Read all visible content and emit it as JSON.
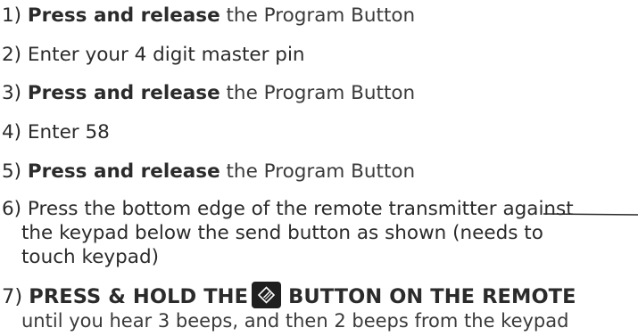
{
  "steps": [
    {
      "num": "1)",
      "bold": "Press and release",
      "rest": " the Program Button"
    },
    {
      "num": "2)",
      "text": "Enter your 4 digit master pin"
    },
    {
      "num": "3)",
      "bold": "Press and release",
      "rest": " the Program Button"
    },
    {
      "num": "4)",
      "text": "Enter 58"
    },
    {
      "num": "5)",
      "bold": "Press and release",
      "rest": " the Program Button"
    },
    {
      "num": "6)",
      "line1": "Press the bottom edge of the remote transmitter against",
      "line2": "the keypad below the send button as shown (needs to",
      "line3": "touch keypad)"
    },
    {
      "num": "7)",
      "bold_a": "PRESS & HOLD THE",
      "bold_b": "BUTTON ON THE REMOTE",
      "line2": "until you hear 3 beeps, and then 2 beeps from the keypad",
      "icon": "send-button-icon"
    }
  ],
  "colors": {
    "text": "#2b2b2b",
    "icon_bg": "#1f1f1f",
    "icon_fg": "#ffffff"
  }
}
